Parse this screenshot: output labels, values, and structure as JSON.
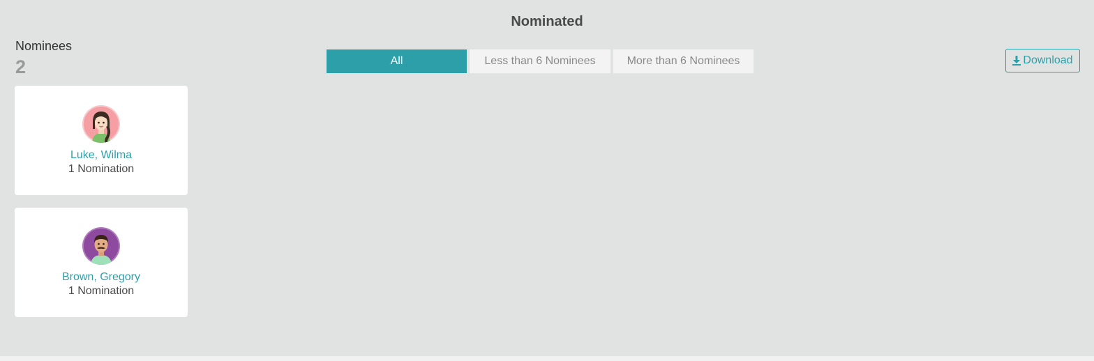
{
  "header": {
    "title": "Nominated"
  },
  "summary": {
    "label": "Nominees",
    "count": "2"
  },
  "filters": {
    "tabs": [
      {
        "label": "All",
        "active": true
      },
      {
        "label": "Less than 6 Nominees",
        "active": false
      },
      {
        "label": "More than 6 Nominees",
        "active": false
      }
    ]
  },
  "actions": {
    "download_label": "Download",
    "download_icon": "download-icon"
  },
  "nominees": [
    {
      "name": "Luke, Wilma",
      "nominations": "1 Nomination",
      "avatar": "female-avatar-icon",
      "avatar_bg": "#f59ea3"
    },
    {
      "name": "Brown, Gregory",
      "nominations": "1 Nomination",
      "avatar": "male-avatar-icon",
      "avatar_bg": "#8e4a9e"
    }
  ],
  "colors": {
    "accent": "#2c9fa9",
    "panel": "#e0e3e2",
    "card": "#ffffff"
  }
}
